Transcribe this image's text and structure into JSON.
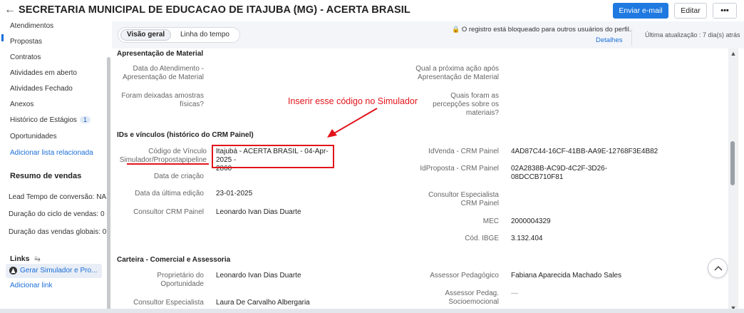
{
  "header": {
    "back_glyph": "←",
    "title": "SECRETARIA MUNICIPAL DE EDUCACAO DE ITAJUBA (MG) - ACERTA BRASIL",
    "send_email_label": "Enviar e-mail",
    "edit_label": "Editar",
    "more_label": "•••"
  },
  "sidebar": {
    "items": [
      {
        "label": "Atendimentos"
      },
      {
        "label": "Propostas"
      },
      {
        "label": "Contratos"
      },
      {
        "label": "Atividades em aberto"
      },
      {
        "label": "Atividades Fechado"
      },
      {
        "label": "Anexos"
      },
      {
        "label": "Histórico de Estágios",
        "badge": "1"
      },
      {
        "label": "Oportunidades"
      },
      {
        "label": "Adicionar lista relacionada"
      }
    ],
    "sales_summary_title": "Resumo de vendas",
    "metrics": [
      "Lead Tempo de conversão: NA",
      "Duração do ciclo de vendas: 0",
      "Duração das vendas globais: 0"
    ],
    "links_title": "Links",
    "links_icon_glyph": "⥱",
    "link_item": "Gerar Simulador e Pro...",
    "add_link": "Adicionar link"
  },
  "tabs": {
    "overview": "Visão geral",
    "timeline": "Linha do tempo"
  },
  "lock": {
    "icon_glyph": "🔒",
    "message": "O registro está bloqueado para outros usuários do perfil.",
    "details_link": "Detalhes",
    "last_updated": "Última atualização : 7 dia(s) atrás"
  },
  "sections": {
    "material": {
      "title": "Apresentação de Material",
      "date_label_1": "Data do Atendimento -",
      "date_label_2": "Apresentação de Material",
      "next_label_1": "Qual a próxima ação após",
      "next_label_2": "Apresentação de Material",
      "samples_label_1": "Foram deixadas amostras",
      "samples_label_2": "físicas?",
      "perception_label_1": "Quais foram as",
      "perception_label_2": "percepções sobre os",
      "perception_label_3": "materiais?"
    },
    "ids": {
      "title": "IDs e vínculos (histórico do CRM Painel)",
      "link_code_label_1": "Código de Vínculo",
      "link_code_label_2": "Simulador/Propostapipeline",
      "link_code_value_1": "Itajubá - ACERTA BRASIL - 04-Apr-2025 -",
      "link_code_value_2": "2860",
      "creation_label": "Data de criação",
      "last_edit_label": "Data da última edição",
      "last_edit_value": "23-01-2025",
      "consultant_label": "Consultor CRM Painel",
      "consultant_value": "Leonardo Ivan Dias Duarte",
      "idvenda_label": "IdVenda - CRM Painel",
      "idvenda_value": "4AD87C44-16CF-41BB-AA9E-12768F3E4B82",
      "idproposta_label": "IdProposta - CRM Painel",
      "idproposta_value_1": "02A2838B-AC9D-4C2F-3D26-",
      "idproposta_value_2": "08DCCB710F81",
      "specialist_label_1": "Consultor Especialista",
      "specialist_label_2": "CRM Painel",
      "mec_label": "MEC",
      "mec_value": "2000004329",
      "ibge_label": "Cód. IBGE",
      "ibge_value": "3.132.404"
    },
    "portfolio": {
      "title": "Carteira - Comercial e Assessoria",
      "owner_label_1": "Proprietário do",
      "owner_label_2": "Oportunidade",
      "owner_value": "Leonardo Ivan Dias Duarte",
      "pedagogical_label": "Assessor Pedagógico",
      "pedagogical_value": "Fabiana Aparecida Machado Sales",
      "specialist_label": "Consultor Especialista",
      "specialist_value": "Laura De Carvalho Albergaria",
      "socio_label_1": "Assessor Pedag.",
      "socio_label_2": "Socioemocional",
      "socio_value": "—"
    }
  },
  "annotation": {
    "text": "Inserir esse código no Simulador",
    "color": "#e2141b"
  },
  "scroll": {
    "up_glyph": "▲",
    "down_glyph": "▼",
    "top_glyph": "⌃"
  }
}
